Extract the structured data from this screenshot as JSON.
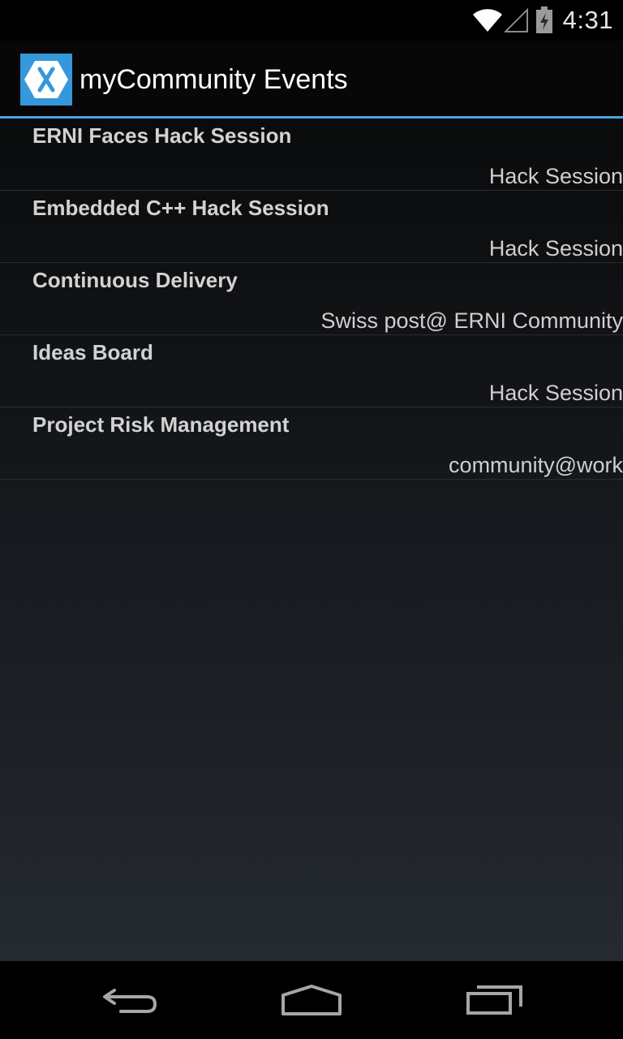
{
  "status_bar": {
    "time": "4:31",
    "icons": [
      "wifi-icon",
      "cell-signal-icon",
      "battery-charging-icon"
    ]
  },
  "action_bar": {
    "app_icon": "xamarin-logo-icon",
    "title": "myCommunity Events",
    "accent_color": "#4aa3df",
    "icon_color": "#3498db"
  },
  "events": [
    {
      "title": "ERNI Faces Hack Session",
      "category": "Hack Session"
    },
    {
      "title": "Embedded C++ Hack Session",
      "category": "Hack Session"
    },
    {
      "title": "Continuous Delivery",
      "category": "Swiss post@ ERNI Community"
    },
    {
      "title": "Ideas Board",
      "category": "Hack Session"
    },
    {
      "title": "Project Risk Management",
      "category": "community@work"
    }
  ],
  "nav_bar": {
    "buttons": [
      "back-icon",
      "home-icon",
      "recent-apps-icon"
    ]
  }
}
